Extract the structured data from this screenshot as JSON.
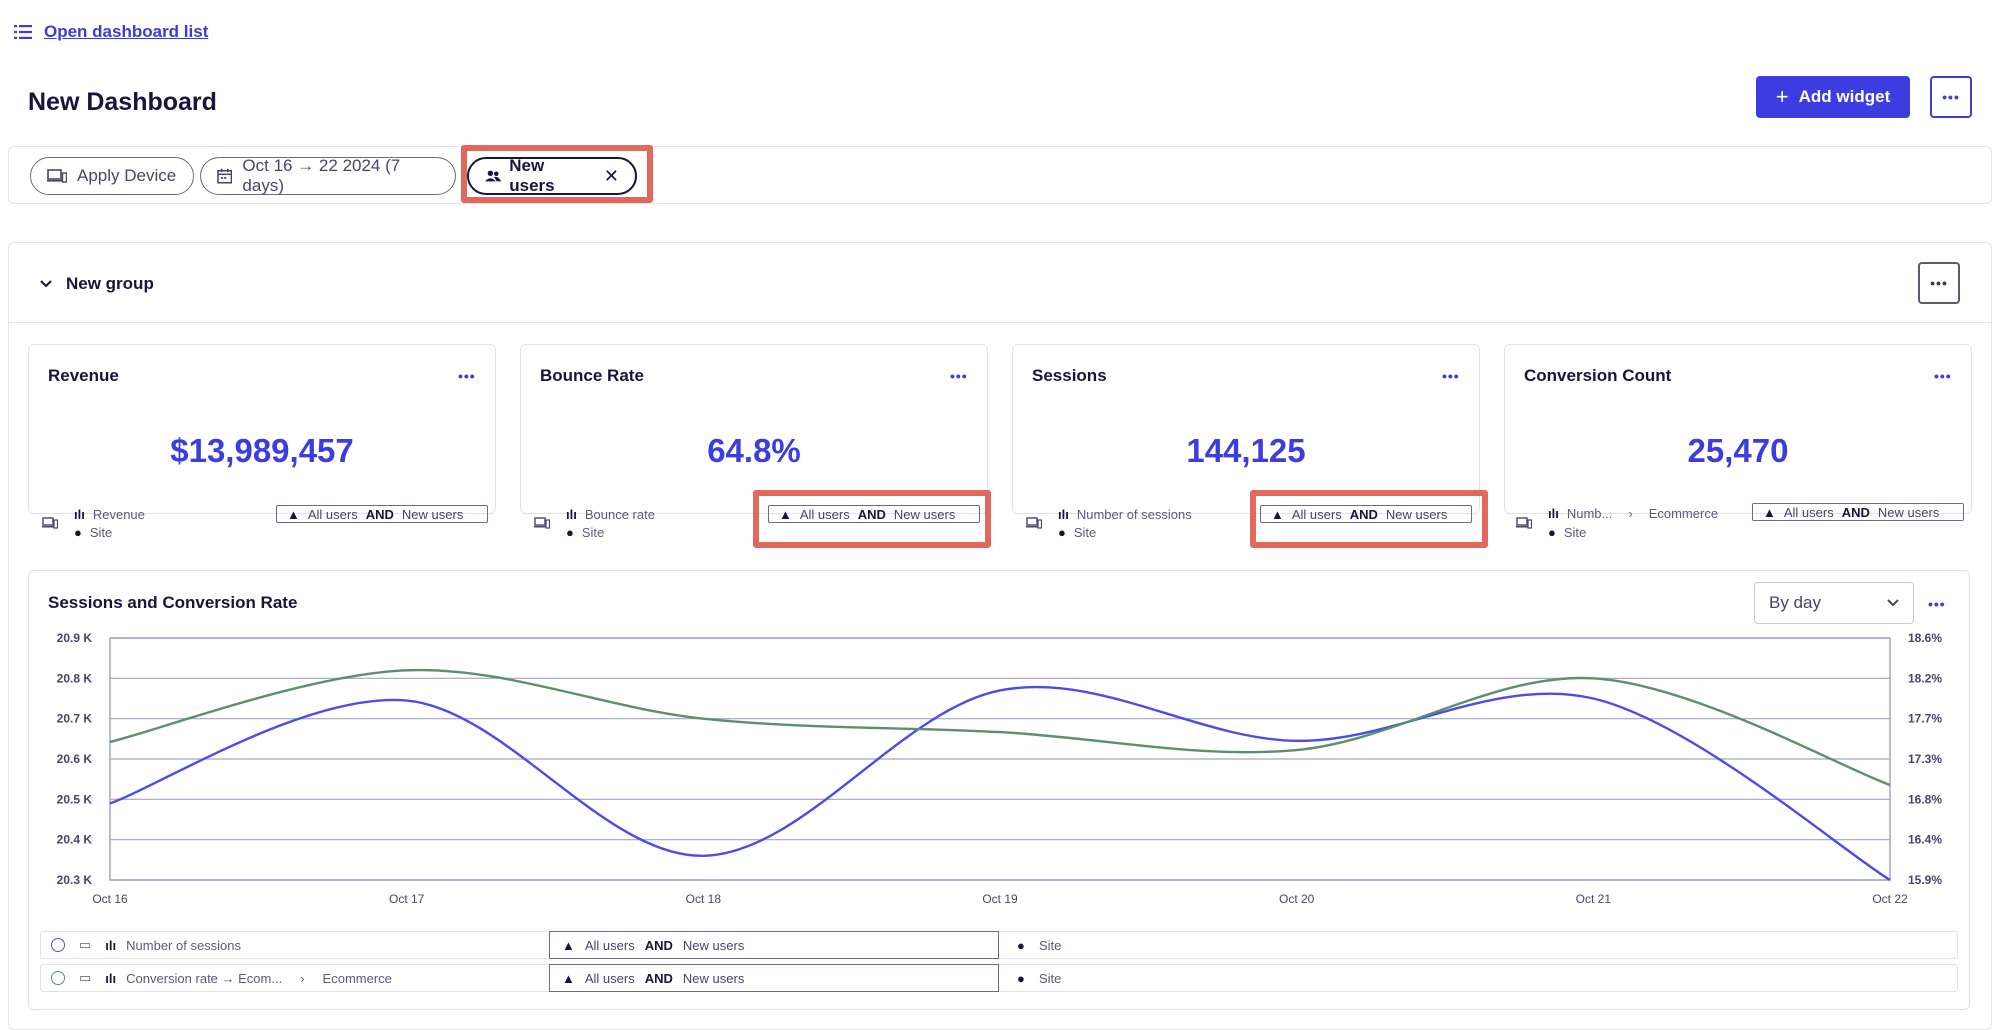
{
  "nav": {
    "open_dashboard_list": "Open dashboard list"
  },
  "page": {
    "title": "New Dashboard"
  },
  "toolbar": {
    "add_widget_label": "Add widget",
    "more": "•••"
  },
  "filters": {
    "device": "Apply Device",
    "date_range": "Oct 16 → 22 2024 (7 days)",
    "segment": "New users"
  },
  "group": {
    "title": "New group",
    "more": "•••"
  },
  "cards": [
    {
      "title": "Revenue",
      "value": "$13,989,457",
      "metric": "Revenue",
      "metric_extra": "",
      "scope": "Site",
      "segment_a": "All users",
      "segment_and": "AND",
      "segment_b": "New users"
    },
    {
      "title": "Bounce Rate",
      "value": "64.8%",
      "metric": "Bounce rate",
      "metric_extra": "",
      "scope": "Site",
      "segment_a": "All users",
      "segment_and": "AND",
      "segment_b": "New users"
    },
    {
      "title": "Sessions",
      "value": "144,125",
      "metric": "Number of sessions",
      "metric_extra": "",
      "scope": "Site",
      "segment_a": "All users",
      "segment_and": "AND",
      "segment_b": "New users"
    },
    {
      "title": "Conversion Count",
      "value": "25,470",
      "metric": "Numb...",
      "metric_extra": "Ecommerce",
      "scope": "Site",
      "segment_a": "All users",
      "segment_and": "AND",
      "segment_b": "New users"
    }
  ],
  "chart_section": {
    "title": "Sessions and Conversion Rate",
    "granularity": "By day",
    "more": "•••"
  },
  "chart_data": {
    "type": "line",
    "title": "Sessions and Conversion Rate",
    "x": [
      "Oct 16",
      "Oct 17",
      "Oct 18",
      "Oct 19",
      "Oct 20",
      "Oct 21",
      "Oct 22"
    ],
    "y_ticks_left": [
      "20.9 K",
      "20.8 K",
      "20.7 K",
      "20.6 K",
      "20.5 K",
      "20.4 K",
      "20.3 K"
    ],
    "y_ticks_right": [
      "18.6%",
      "18.2%",
      "17.7%",
      "17.3%",
      "16.8%",
      "16.4%",
      "15.9%"
    ],
    "ylim_left": [
      20300,
      20900
    ],
    "ylim_right": [
      15.9,
      18.6
    ],
    "grid": true,
    "series": [
      {
        "name": "Number of sessions",
        "axis": "left",
        "color": "#4a4de6",
        "values": [
          20490,
          20745,
          20360,
          20770,
          20645,
          20750,
          20300
        ]
      },
      {
        "name": "Conversion rate → Ecom...",
        "axis": "right",
        "color": "#5c8f6c",
        "values": [
          17.44,
          18.24,
          17.7,
          17.55,
          17.35,
          18.15,
          16.96
        ]
      }
    ]
  },
  "legend": [
    {
      "metric": "Number of sessions",
      "metric_extra": "",
      "segment_a": "All users",
      "segment_and": "AND",
      "segment_b": "New users",
      "scope": "Site",
      "color": "#4a4de6"
    },
    {
      "metric": "Conversion rate → Ecom...",
      "metric_extra": "Ecommerce",
      "segment_a": "All users",
      "segment_and": "AND",
      "segment_b": "New users",
      "scope": "Site",
      "color": "#5c8f6c"
    }
  ],
  "colors": {
    "accent": "#3b3de0",
    "highlight": "#e0695c",
    "title": "#16153f"
  }
}
